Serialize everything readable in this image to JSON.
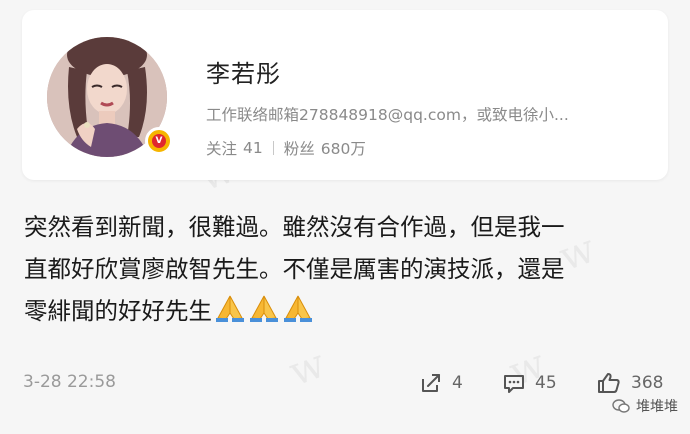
{
  "profile": {
    "name": "李若彤",
    "description": "工作联络邮箱278848918@qq.com，或致电徐小...",
    "following_label": "关注",
    "following_count": "41",
    "followers_label": "粉丝",
    "followers_count": "680万"
  },
  "post": {
    "lines": [
      "突然看到新聞，很難過。雖然沒有合作過，但是我一",
      "直都好欣賞廖啟智先生。不僅是厲害的演技派，還是",
      "零緋聞的好好先生"
    ],
    "emoji": "folded-hands",
    "emoji_count": 3,
    "timestamp": "3-28 22:58"
  },
  "actions": {
    "share_count": "4",
    "comment_count": "45",
    "like_count": "368"
  },
  "watermark": {
    "text": "堆堆堆"
  },
  "colors": {
    "verified_badge": "#f6b500",
    "verified_core": "#e0272f",
    "text_primary": "#1a1a1a",
    "text_secondary": "#8a8a8a",
    "background": "#f6f6f6"
  }
}
